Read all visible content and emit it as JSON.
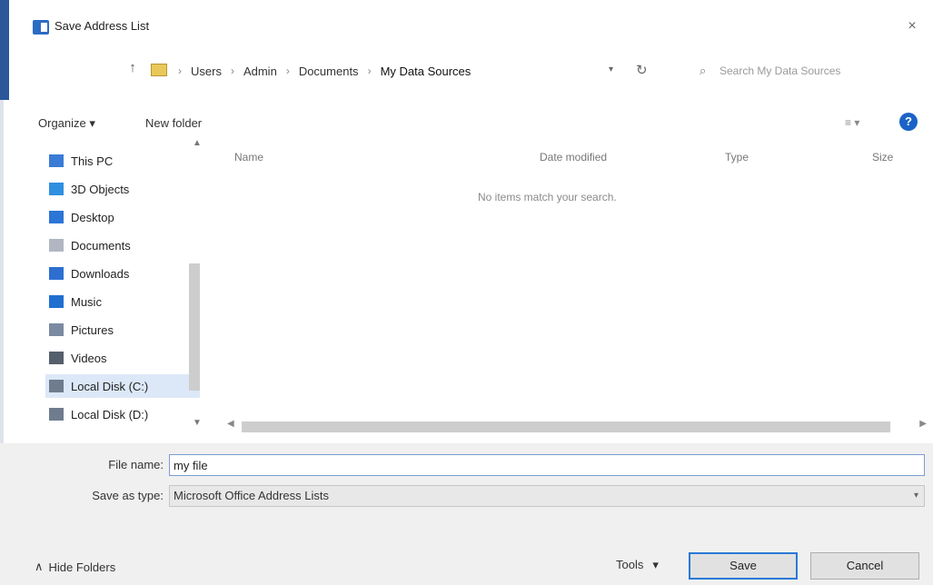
{
  "window": {
    "title": "Save Address List",
    "close_glyph": "×"
  },
  "address_bar": {
    "breadcrumb": [
      "Users",
      "Admin",
      "Documents",
      "My Data Sources"
    ],
    "separator": "›",
    "search_placeholder": "Search My Data Sources"
  },
  "toolbar": {
    "organize_label": "Organize ▾",
    "new_folder_label": "New folder",
    "view_label": "≡ ▾",
    "help_label": "?"
  },
  "nav": {
    "items": [
      {
        "label": "This PC",
        "icon": "computer-icon",
        "color": "#3a7bd5"
      },
      {
        "label": "3D Objects",
        "icon": "cube-icon",
        "color": "#2f8fe0"
      },
      {
        "label": "Desktop",
        "icon": "desktop-icon",
        "color": "#2b75d6"
      },
      {
        "label": "Documents",
        "icon": "document-icon",
        "color": "#b0b7c3"
      },
      {
        "label": "Downloads",
        "icon": "download-icon",
        "color": "#2d6fd1"
      },
      {
        "label": "Music",
        "icon": "music-icon",
        "color": "#1f6fd0"
      },
      {
        "label": "Pictures",
        "icon": "pictures-icon",
        "color": "#7a8aa0"
      },
      {
        "label": "Videos",
        "icon": "video-icon",
        "color": "#555e6b"
      },
      {
        "label": "Local Disk (C:)",
        "icon": "drive-icon",
        "color": "#6f7c8e"
      },
      {
        "label": "Local Disk (D:)",
        "icon": "drive-icon",
        "color": "#6f7c8e"
      }
    ],
    "selected_index": 8
  },
  "file_list": {
    "columns": [
      "Name",
      "Date modified",
      "Type",
      "Size"
    ],
    "empty_message": "No items match your search."
  },
  "form": {
    "file_name_label": "File name:",
    "file_name_value": "my file",
    "save_type_label": "Save as type:",
    "save_type_value": "Microsoft Office Address Lists"
  },
  "footer": {
    "hide_folders_label": "Hide Folders",
    "tools_label": "Tools",
    "save_label": "Save",
    "cancel_label": "Cancel"
  },
  "colors": {
    "accent": "#2b579a",
    "help": "#1b63c6",
    "primary_border": "#2a79d7"
  }
}
